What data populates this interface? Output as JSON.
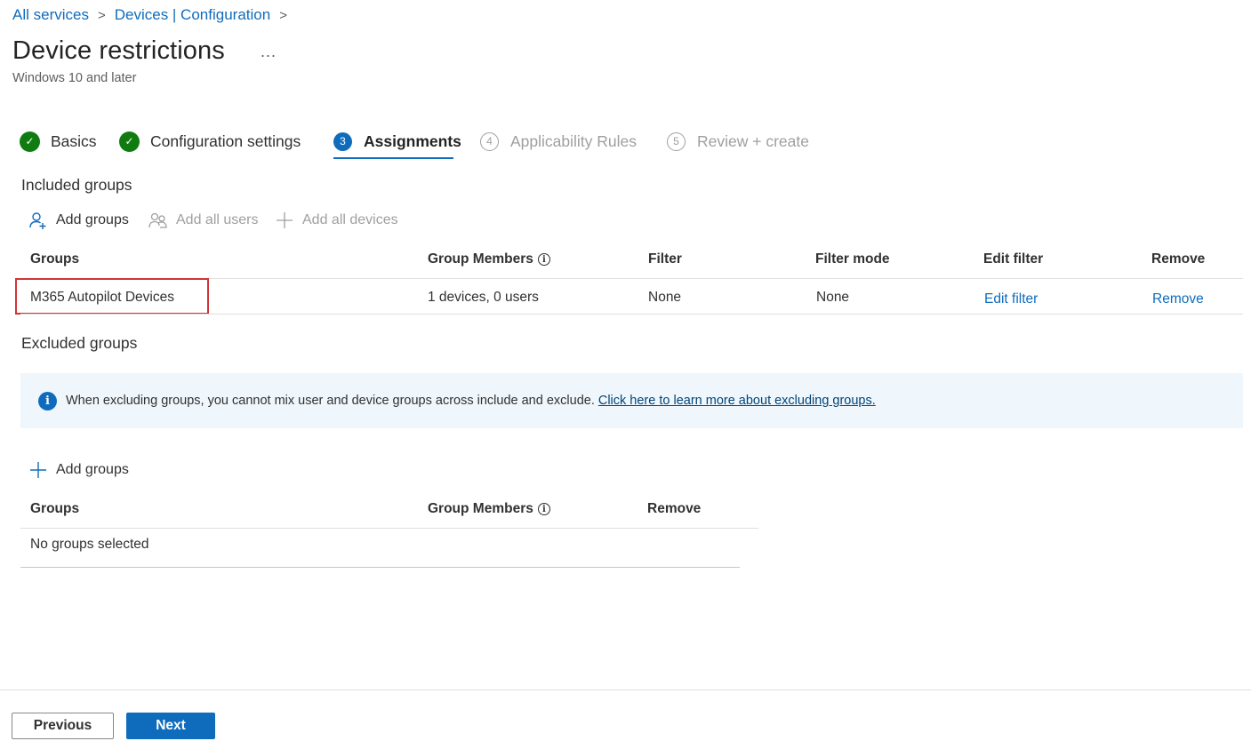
{
  "breadcrumb": {
    "items": [
      "All services",
      "Devices | Configuration"
    ],
    "separator": ">"
  },
  "page": {
    "title": "Device restrictions",
    "more": "...",
    "subtitle": "Windows 10 and later"
  },
  "steps": [
    {
      "label": "Basics",
      "state": "done",
      "marker": "✓"
    },
    {
      "label": "Configuration settings",
      "state": "done",
      "marker": "✓"
    },
    {
      "label": "Assignments",
      "state": "current",
      "marker": "3"
    },
    {
      "label": "Applicability Rules",
      "state": "todo",
      "marker": "4"
    },
    {
      "label": "Review + create",
      "state": "todo",
      "marker": "5"
    }
  ],
  "included": {
    "heading": "Included groups",
    "commands": {
      "add_groups": "Add groups",
      "add_all_users": "Add all users",
      "add_all_devices": "Add all devices"
    },
    "columns": [
      "Groups",
      "Group Members",
      "Filter",
      "Filter mode",
      "Edit filter",
      "Remove"
    ],
    "rows": [
      {
        "group": "M365 Autopilot Devices",
        "members": "1 devices, 0 users",
        "filter": "None",
        "filter_mode": "None",
        "edit_filter": "Edit filter",
        "remove": "Remove"
      }
    ]
  },
  "excluded": {
    "heading": "Excluded groups",
    "info_text": "When excluding groups, you cannot mix user and device groups across include and exclude.",
    "info_link": "Click here to learn more about excluding groups.",
    "add_groups": "Add groups",
    "columns": [
      "Groups",
      "Group Members",
      "Remove"
    ],
    "empty_text": "No groups selected"
  },
  "footer": {
    "previous": "Previous",
    "next": "Next"
  },
  "colors": {
    "accent": "#0f6cbd",
    "success": "#107c10",
    "highlight": "#d13438"
  }
}
